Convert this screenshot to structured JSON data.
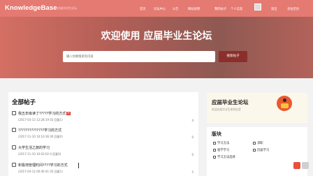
{
  "header": {
    "brand": "KnowledgeBase",
    "brand_sub": "应届毕业生论坛",
    "nav": [
      "首页",
      "论坛中心",
      "公告",
      "网站说明",
      "我的帖子",
      "个人信息",
      "退出",
      "去往后台"
    ]
  },
  "hero": {
    "title": "欢迎使用 应届毕业生论坛",
    "search_placeholder": "输入你要搜索的内容",
    "search_button": "搜索帖子"
  },
  "main": {
    "section_title": "全部帖子",
    "posts": [
      {
        "title": "我五年级读了?????学习的方式",
        "badge": "热",
        "meta": "(2017-03-13 12:28:19 03 回复1)",
        "count": "4"
      },
      {
        "title": "??????????????学习的方式",
        "badge": "",
        "meta": "(2017-11-10 10:10:36 00 回复0)",
        "count": "0"
      },
      {
        "title": "大学生活之旅的学习",
        "badge": "",
        "meta": "(2017-11-10 10:03:02 0 回复0)",
        "count": "0"
      },
      {
        "title": "积极地管理时间????学习的方式",
        "badge": "",
        "meta": "(2017-04-12 00:40:41 03 回复1)",
        "count": "5"
      }
    ]
  },
  "sidebar": {
    "card_title": "应届毕业生论坛",
    "card_desc": "欢迎应届毕业生来到这里",
    "board_title": "版块",
    "boards": [
      "学习方法",
      "求职",
      "留学学习",
      "历届学习",
      "学习方法选择"
    ]
  },
  "colors": {
    "nav_bg": "#e47a72",
    "hero_start": "#d46f63",
    "hero_end": "#8e5952",
    "button": "#8b2f2c"
  }
}
